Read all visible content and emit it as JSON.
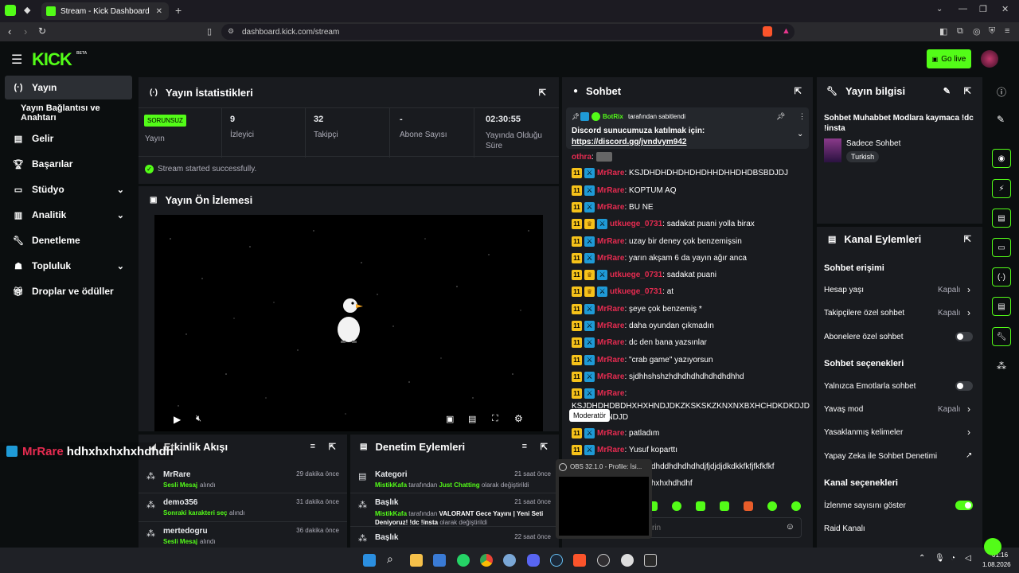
{
  "browser": {
    "tab_title": "Stream - Kick Dashboard",
    "url": "dashboard.kick.com/stream"
  },
  "header": {
    "logo": "KICK",
    "logo_sup": "BETA",
    "go_live": "Go live"
  },
  "sidebar": {
    "items": [
      {
        "label": "Yayın",
        "icon": "broadcast-icon"
      },
      {
        "label": "Yayın Bağlantısı ve Anahtarı",
        "icon": ""
      },
      {
        "label": "Gelir",
        "icon": "revenue-icon"
      },
      {
        "label": "Başarılar",
        "icon": "trophy-icon"
      },
      {
        "label": "Stüdyo",
        "icon": "studio-icon"
      },
      {
        "label": "Analitik",
        "icon": "analytics-icon"
      },
      {
        "label": "Denetleme",
        "icon": "wrench-icon"
      },
      {
        "label": "Topluluk",
        "icon": "community-icon"
      },
      {
        "label": "Droplar ve ödüller",
        "icon": "gift-icon"
      }
    ]
  },
  "stats": {
    "title": "Yayın İstatistikleri",
    "status_badge": "SORUNSUZ",
    "cols": [
      {
        "value": "",
        "label": "Yayın"
      },
      {
        "value": "9",
        "label": "İzleyici"
      },
      {
        "value": "32",
        "label": "Takipçi"
      },
      {
        "value": "-",
        "label": "Abone Sayısı"
      },
      {
        "value": "02:30:55",
        "label": "Yayında Olduğu Süre"
      }
    ],
    "success": "Stream started successfully."
  },
  "preview": {
    "title": "Yayın Ön İzlemesi"
  },
  "overlay_chat": {
    "user": "MrRare",
    "text": "hdhxhxhxhxhdhdh"
  },
  "activity": {
    "title": "Etkinlik Akışı",
    "items": [
      {
        "name": "MrRare",
        "action": "Sesli Mesaj",
        "suffix": "alındı",
        "time": "29 dakika önce"
      },
      {
        "name": "demo356",
        "action": "Sonraki karakteri seç",
        "suffix": "alındı",
        "time": "31 dakika önce"
      },
      {
        "name": "mertedogru",
        "action": "Sesli Mesaj",
        "suffix": "alındı",
        "time": "36 dakika önce"
      }
    ]
  },
  "moderation": {
    "title": "Denetim Eylemleri",
    "items": [
      {
        "title": "Kategori",
        "actor": "MistikKafa",
        "mid": "tarafından",
        "value": "Just Chatting",
        "tail": "olarak değiştirildi",
        "time": "21 saat önce"
      },
      {
        "title": "Başlık",
        "actor": "MistikKafa",
        "mid": "tarafından",
        "value": "VALORANT Gece Yayını | Yeni Seti Deniyoruz! !dc !insta",
        "tail": "olarak değiştirildi",
        "time": "21 saat önce"
      },
      {
        "title": "Başlık",
        "actor": "",
        "mid": "",
        "value": "",
        "tail": "",
        "time": "22 saat önce"
      }
    ]
  },
  "chat": {
    "title": "Sohbet",
    "pinned": {
      "by": "BotRix",
      "by_suffix": "tarafından sabitlendi",
      "text": "Discord sunucumuza katılmak için:",
      "link": "https://discord.gg/jvndvym942"
    },
    "lines": [
      {
        "user": "othra",
        "text": ":",
        "color": "#e52b50"
      },
      {
        "user": "MrRare",
        "text": ": KSJDHDHDHDHDHDHHDHHDHDBSBDJDJ",
        "color": "#e52b50"
      },
      {
        "user": "MrRare",
        "text": ": KOPTUM AQ",
        "color": "#e52b50"
      },
      {
        "user": "MrRare",
        "text": ": BU NE",
        "color": "#e52b50"
      },
      {
        "user": "utkuege_0731",
        "text": ": sadakat puani yolla birax",
        "color": "#e52b50"
      },
      {
        "user": "MrRare",
        "text": ": uzay bir deney çok benzemişsin",
        "color": "#e52b50"
      },
      {
        "user": "MrRare",
        "text": ": yarın akşam 6 da yayın ağır anca",
        "color": "#e52b50"
      },
      {
        "user": "utkuege_0731",
        "text": ": sadakat puani",
        "color": "#e52b50"
      },
      {
        "user": "utkuege_0731",
        "text": ": at",
        "color": "#e52b50"
      },
      {
        "user": "MrRare",
        "text": ": şeye çok benzemiş *",
        "color": "#e52b50"
      },
      {
        "user": "MrRare",
        "text": ": daha oyundan çıkmadın",
        "color": "#e52b50"
      },
      {
        "user": "MrRare",
        "text": ": dc den bana yazsınlar",
        "color": "#e52b50"
      },
      {
        "user": "MrRare",
        "text": ": \"crab game\" yazıyorsun",
        "color": "#e52b50"
      },
      {
        "user": "MrRare",
        "text": ": sjdhhshshzhdhdhdhdhdhdhdhhd",
        "color": "#e52b50"
      },
      {
        "user": "MrRare",
        "text": ":",
        "color": "#e52b50"
      }
    ],
    "long_line": "KSJDHDHDBDHXHXHNDJDKZKSKSKZKNXNXBXHCHDKDKDJDKDKDJJXNDJD",
    "tooltip": "Moderatör",
    "line_patladim": ": patladım",
    "line_yusuf": ": Yusuf koparttı",
    "line_frag1": "dhddhdhdhdhdjfjdjdjdkdkkfkfjfkfkfkf",
    "line_frag2": "hxhxhdhdhf",
    "input_placeholder": "rin"
  },
  "obs": {
    "title": "OBS 32.1.0 - Profile: İsi..."
  },
  "stream_info": {
    "title": "Yayın bilgisi",
    "stream_title": "Sohbet Muhabbet Modlara kaymaca !dc !insta",
    "category": "Sadece Sohbet",
    "language": "Turkish"
  },
  "channel_actions": {
    "title": "Kanal Eylemleri",
    "chat_access": "Sohbet erişimi",
    "account_age": "Hesap yaşı",
    "account_age_val": "Kapalı",
    "followers_only": "Takipçilere özel sohbet",
    "followers_only_val": "Kapalı",
    "subs_only": "Abonelere özel sohbet",
    "chat_options": "Sohbet seçenekleri",
    "emote_only": "Yalnızca Emotlarla sohbet",
    "slow_mode": "Yavaş mod",
    "slow_mode_val": "Kapalı",
    "banned_words": "Yasaklanmış kelimeler",
    "ai_mod": "Yapay Zeka ile Sohbet Denetimi",
    "channel_options": "Kanal seçenekleri",
    "show_viewers": "İzlenme sayısını göster",
    "raid": "Raid Kanalı"
  },
  "taskbar": {
    "time": "01:16",
    "date": "1.08.2026"
  }
}
